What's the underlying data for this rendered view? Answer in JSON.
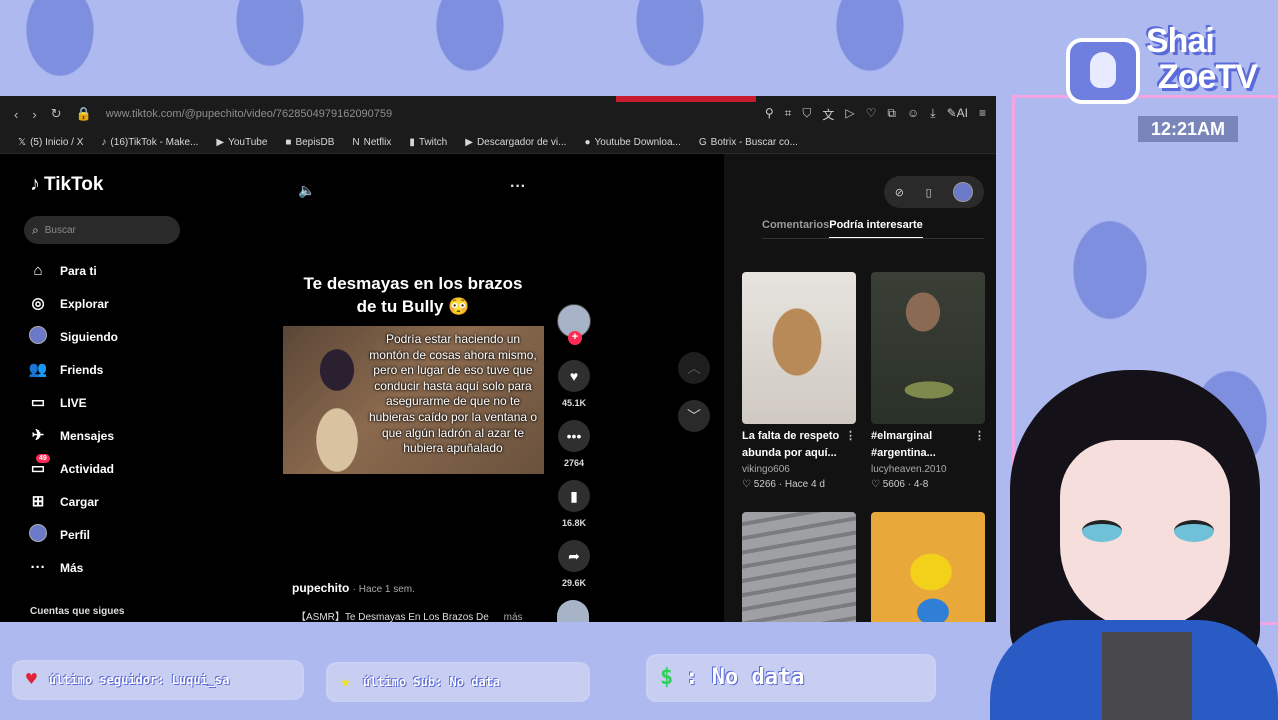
{
  "overlay": {
    "logo_line1": "Shai",
    "logo_line2": "ZoeTV",
    "clock": "12:21AM",
    "last_follower": "último seguidor: Luqui_sa",
    "last_sub": "último Sub: No data",
    "donation": ": No data",
    "icons": [
      "heart-icon",
      "star-icon",
      "dollar-icon"
    ],
    "colors": {
      "background": "#aeb9ef",
      "accent_pink": "#f3a6e3",
      "brand_blue": "#5a6ad8"
    }
  },
  "browser": {
    "url": "www.tiktok.com/@pupechito/video/7628504979162090759",
    "bookmarks": [
      {
        "icon": "x-icon",
        "glyph": "𝕏",
        "label": "(5) Inicio / X"
      },
      {
        "icon": "tiktok-icon",
        "glyph": "♪",
        "label": "(16)TikTok - Make..."
      },
      {
        "icon": "youtube-icon",
        "glyph": "▶",
        "label": "YouTube"
      },
      {
        "icon": "bepisdb-icon",
        "glyph": "■",
        "label": "BepisDB"
      },
      {
        "icon": "netflix-icon",
        "glyph": "N",
        "label": "Netflix"
      },
      {
        "icon": "twitch-icon",
        "glyph": "▮",
        "label": "Twitch"
      },
      {
        "icon": "downloader-icon",
        "glyph": "▶",
        "label": "Descargador de vi..."
      },
      {
        "icon": "youtube-download-icon",
        "glyph": "●",
        "label": "Youtube Downloa..."
      },
      {
        "icon": "google-icon",
        "glyph": "G",
        "label": "Botrix - Buscar co..."
      }
    ]
  },
  "tiktok": {
    "logo": "TikTok",
    "search_placeholder": "Buscar",
    "menu": [
      {
        "name": "para-ti",
        "icon": "home-icon",
        "glyph": "⌂",
        "label": "Para ti"
      },
      {
        "name": "explorar",
        "icon": "compass-icon",
        "glyph": "◎",
        "label": "Explorar"
      },
      {
        "name": "siguiendo",
        "icon": "following-avatar-icon",
        "glyph": "",
        "label": "Siguiendo"
      },
      {
        "name": "friends",
        "icon": "friends-icon",
        "glyph": "👥",
        "label": "Friends"
      },
      {
        "name": "live",
        "icon": "live-icon",
        "glyph": "▭",
        "label": "LIVE"
      },
      {
        "name": "mensajes",
        "icon": "inbox-icon",
        "glyph": "✈",
        "label": "Mensajes"
      },
      {
        "name": "actividad",
        "icon": "activity-icon",
        "glyph": "▭",
        "label": "Actividad",
        "badge": "49"
      },
      {
        "name": "cargar",
        "icon": "upload-icon",
        "glyph": "⊞",
        "label": "Cargar"
      },
      {
        "name": "perfil",
        "icon": "profile-avatar-icon",
        "glyph": "",
        "label": "Perfil"
      },
      {
        "name": "mas",
        "icon": "more-icon",
        "glyph": "···",
        "label": "Más"
      }
    ],
    "following_header": "Cuentas que sigues",
    "video": {
      "title": "Te desmayas en los brazos de tu Bully 😳",
      "caption": "Podría estar haciendo un montón de cosas ahora mismo, pero en lugar de eso tuve que conducir hasta aquí solo para asegurarme de que no te hubieras caído por la ventana o que algún ladrón al azar te hubiera apuñalado",
      "author": "pupechito",
      "time": "· Hace 1 sem.",
      "description": "【ASMR】Te Desmayas En Los Brazos De",
      "more_label": "más",
      "likes": "45.1K",
      "comments": "2764",
      "saves": "16.8K",
      "shares": "29.6K"
    },
    "right_panel": {
      "tabs": [
        "Comentarios",
        "Podría interesarte"
      ],
      "active_tab": 1,
      "cards": [
        {
          "title": "La falta de respeto abunda por aquí...",
          "user": "vikingo606",
          "likes": "5266",
          "date": "· Hace 4 d",
          "thumb": "dog"
        },
        {
          "title": "#elmarginal #argentina...",
          "user": "lucyheaven.2010",
          "likes": "5606",
          "date": "· 4-8",
          "thumb": "man"
        },
        {
          "title": "",
          "user": "",
          "likes": "",
          "date": "",
          "thumb": "stairs"
        },
        {
          "title": "",
          "user": "",
          "likes": "",
          "date": "",
          "thumb": "hero"
        }
      ]
    }
  }
}
